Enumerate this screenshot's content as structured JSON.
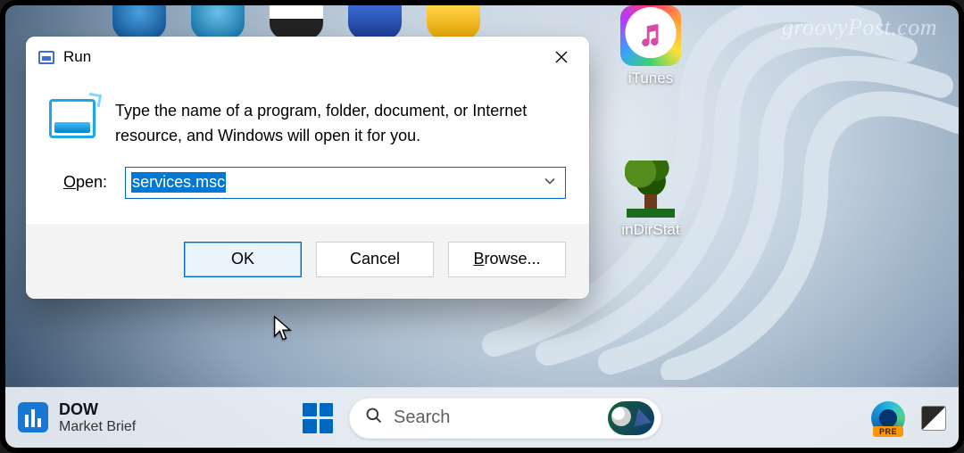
{
  "watermark": "groovyPost.com",
  "desktop": {
    "icons": [
      {
        "label": "iTunes"
      },
      {
        "label": "inDirStat"
      }
    ]
  },
  "dialog": {
    "title": "Run",
    "instruction": "Type the name of a program, folder, document, or Internet resource, and Windows will open it for you.",
    "open_label_pre": "O",
    "open_label_rest": "pen:",
    "input_value": "services.msc",
    "buttons": {
      "ok": "OK",
      "cancel": "Cancel",
      "browse_pre": "B",
      "browse_rest": "rowse..."
    }
  },
  "taskbar": {
    "widget_title": "DOW",
    "widget_sub": "Market Brief",
    "search_placeholder": "Search",
    "edge_badge": "PRE"
  }
}
